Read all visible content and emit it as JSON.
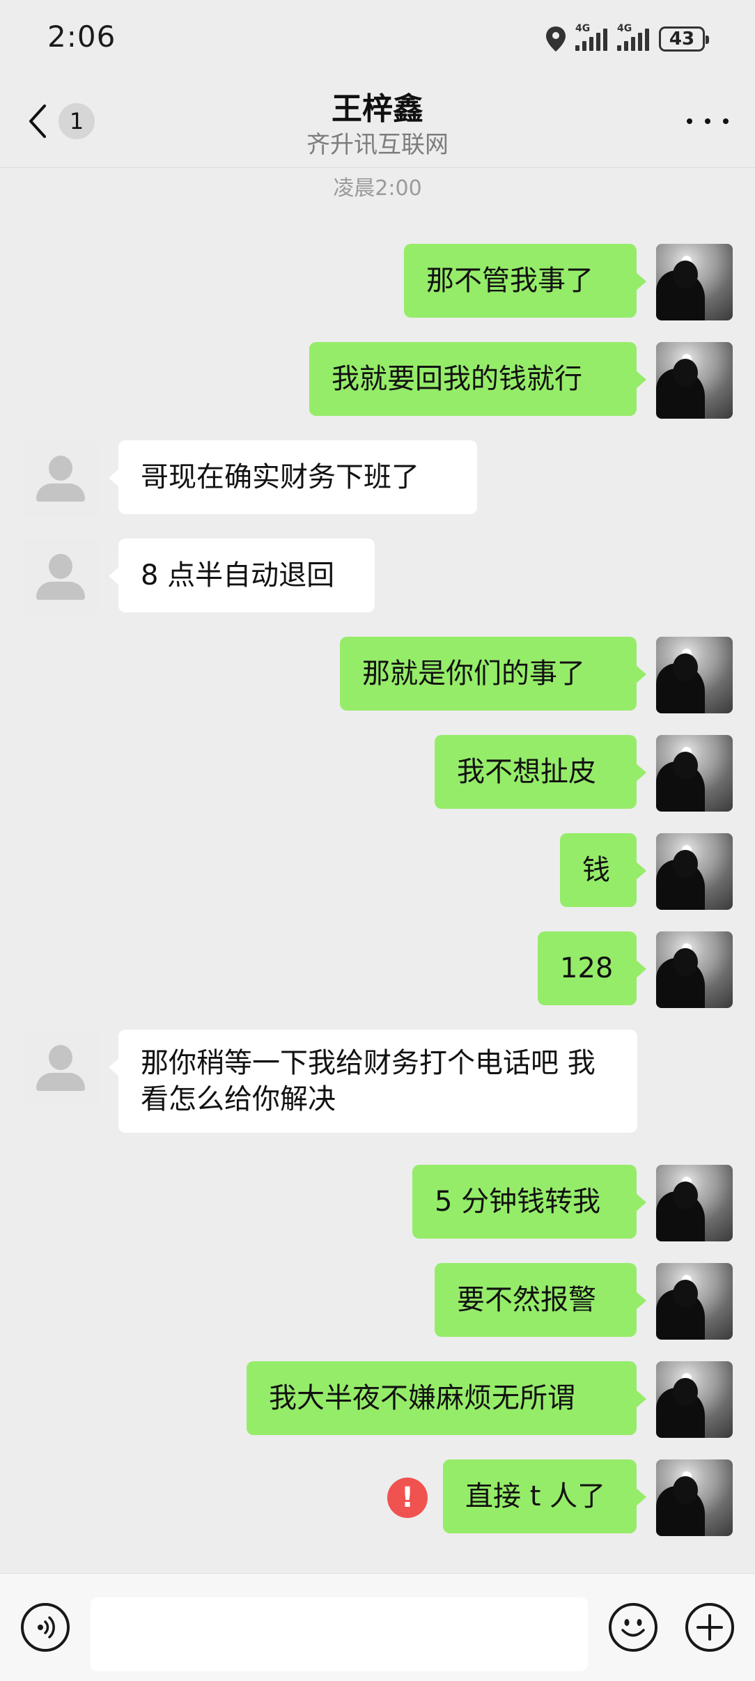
{
  "status_bar": {
    "time": "2:06",
    "network1": "4G",
    "network2": "4G",
    "battery": "43"
  },
  "header": {
    "back_count": "1",
    "title": "王梓鑫",
    "subtitle": "齐升讯互联网"
  },
  "timestamp": "凌晨2:00",
  "messages": [
    {
      "from": "me",
      "text": "那不管我事了"
    },
    {
      "from": "me",
      "text": "我就要回我的钱就行"
    },
    {
      "from": "other",
      "text": "哥现在确实财务下班了"
    },
    {
      "from": "other",
      "text": "8 点半自动退回"
    },
    {
      "from": "me",
      "text": "那就是你们的事了"
    },
    {
      "from": "me",
      "text": "我不想扯皮"
    },
    {
      "from": "me",
      "text": "钱"
    },
    {
      "from": "me",
      "text": "128"
    },
    {
      "from": "other",
      "text": "那你稍等一下我给财务打个电话吧 我看怎么给你解决"
    },
    {
      "from": "me",
      "text": "5 分钟钱转我"
    },
    {
      "from": "me",
      "text": "要不然报警"
    },
    {
      "from": "me",
      "text": "我大半夜不嫌麻烦无所谓"
    },
    {
      "from": "me",
      "text": "直接 t 人了",
      "failed": true
    }
  ],
  "input": {
    "placeholder": ""
  },
  "icons": {
    "back": "chevron-left-icon",
    "more": "more-dots-icon",
    "voice": "voice-icon",
    "emoji": "emoji-icon",
    "plus": "plus-icon",
    "error": "error-icon"
  },
  "colors": {
    "my_bubble": "#95ec69",
    "other_bubble": "#ffffff",
    "background": "#ededed",
    "error": "#f05250"
  }
}
